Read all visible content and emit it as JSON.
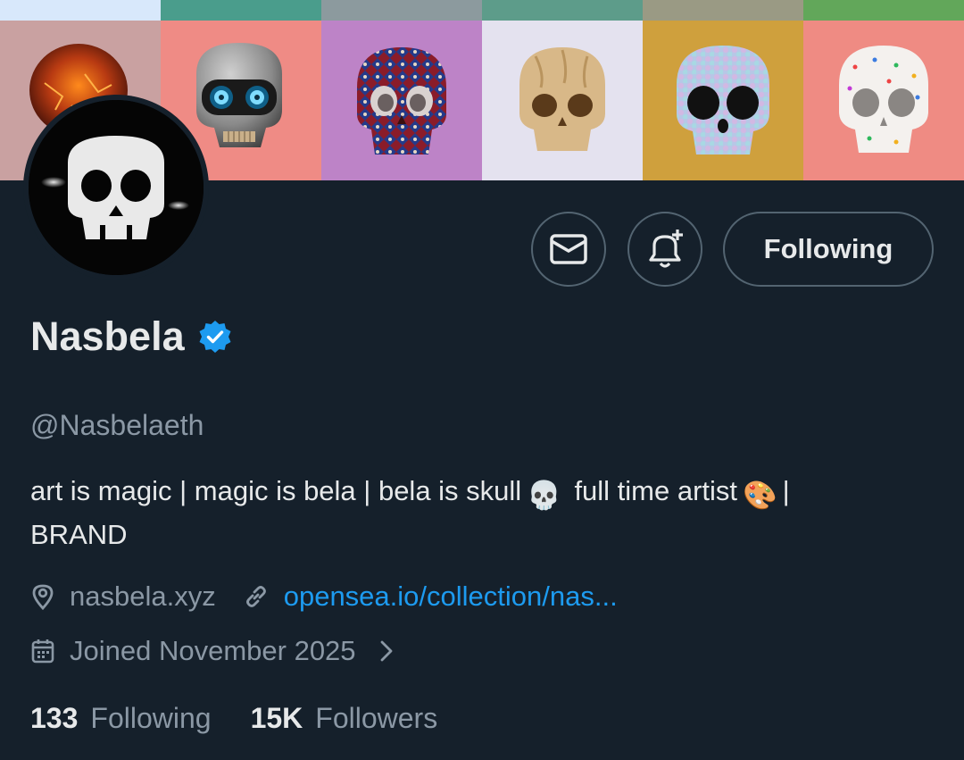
{
  "banner": {
    "top_strip_colors": [
      "#d8e8fb",
      "#4a9d8c",
      "#8c9a9e",
      "#5d9c8a",
      "#9a9a84",
      "#62a75a"
    ],
    "tiles": [
      {
        "name": "lava-skull",
        "bg": "#c9a1a1"
      },
      {
        "name": "robot-skull",
        "bg": "#ef8b85"
      },
      {
        "name": "carpet-skull",
        "bg": "#bd83c7"
      },
      {
        "name": "cookie-skull",
        "bg": "#e4e2ef"
      },
      {
        "name": "pastel-skull",
        "bg": "#cfa03d"
      },
      {
        "name": "sprinkle-skull",
        "bg": "#ef8b83"
      }
    ]
  },
  "actions": {
    "message_icon": "mail-icon",
    "notify_icon": "bell-plus-icon",
    "following_label": "Following"
  },
  "profile": {
    "name": "Nasbela",
    "verified_icon": "verified-badge-icon",
    "handle": "@Nasbelaeth",
    "bio_part1": "art is magic | magic is bela | bela is skull",
    "bio_emoji1": "💀",
    "bio_part2": "full time artist",
    "bio_emoji2": "🎨",
    "bio_part3": "|",
    "bio_part4": "BRAND",
    "location": "nasbela.xyz",
    "website": "opensea.io/collection/nas...",
    "joined": "Joined November 2025"
  },
  "stats": {
    "following_count": "133",
    "following_label": "Following",
    "followers_count": "15K",
    "followers_label": "Followers"
  },
  "colors": {
    "background": "#15202b",
    "accent_blue": "#1d9bf0",
    "muted_text": "#8b98a5",
    "border": "#536471"
  }
}
